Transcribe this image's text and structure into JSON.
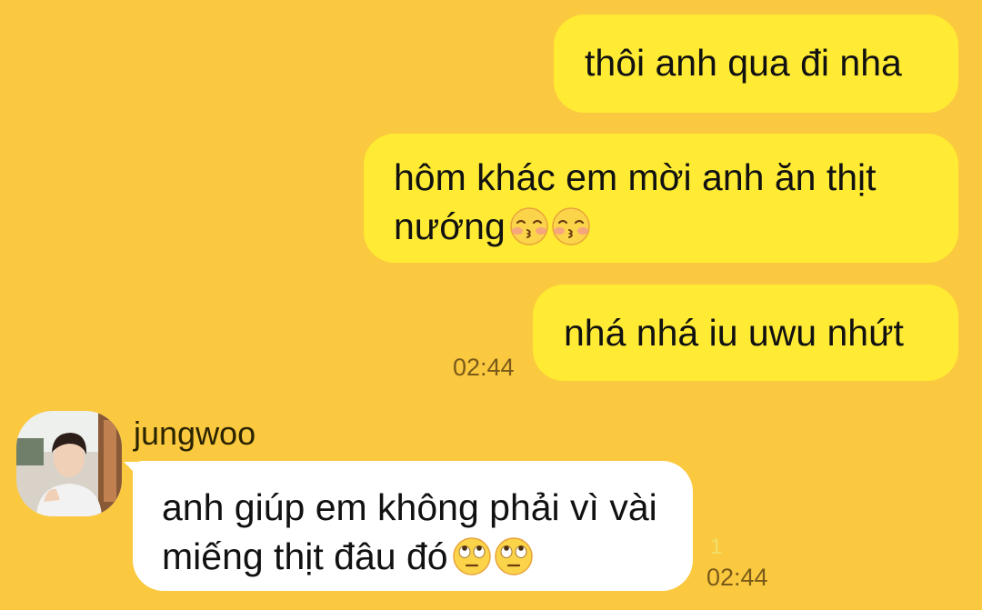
{
  "messages": {
    "out1": {
      "text": "thôi anh qua đi nha"
    },
    "out2": {
      "text": "hôm khác em mời anh ăn thịt nướng",
      "emojis": [
        "kissing-smiling-eyes-emoji",
        "kissing-smiling-eyes-emoji"
      ]
    },
    "out3": {
      "text": "nhá nhá iu uwu nhứt",
      "time": "02:44"
    },
    "in1": {
      "sender": "jungwoo",
      "text": "anh giúp em không phải vì vài miếng thịt đâu đó",
      "emojis": [
        "face-with-rolling-eyes-emoji",
        "face-with-rolling-eyes-emoji"
      ],
      "unread_count": "1",
      "time": "02:44"
    }
  },
  "colors": {
    "background": "#fbc93f",
    "outgoing_bubble": "#ffeb33",
    "incoming_bubble": "#ffffff",
    "timestamp": "#7a5a1a",
    "unread_count": "#f2e06b"
  }
}
